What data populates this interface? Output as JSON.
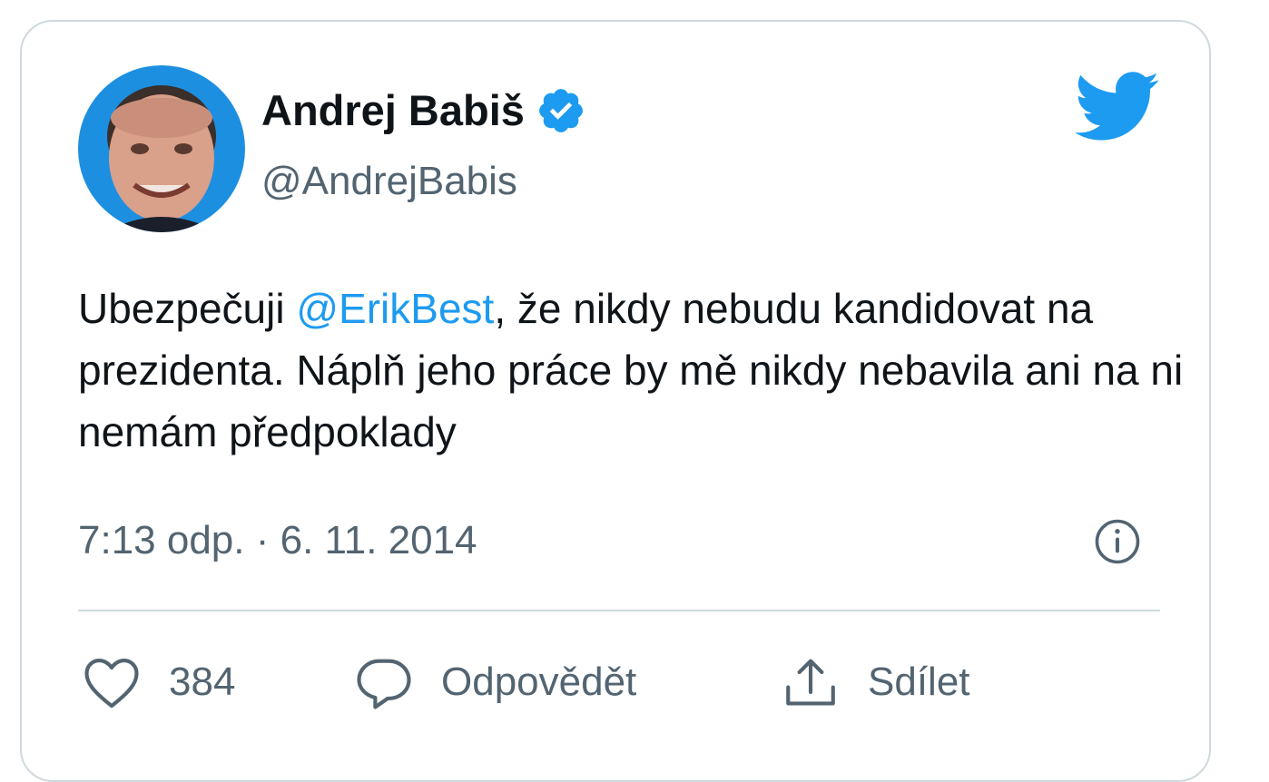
{
  "tweet": {
    "author_name": "Andrej Babiš",
    "handle": "@AndrejBabis",
    "text_before": "Ubezpečuji ",
    "mention": "@ErikBest",
    "text_after": ", že nikdy nebudu kandidovat na prezidenta. Náplň jeho práce by mě nikdy nebavila ani na ni nemám předpoklady",
    "timestamp": "7:13 odp. · 6. 11. 2014",
    "likes": "384",
    "reply_label": "Odpovědět",
    "share_label": "Sdílet"
  },
  "icons": {
    "verified": "verified-badge-icon",
    "brand": "twitter-bird-icon",
    "info": "info-icon",
    "like": "heart-icon",
    "reply": "speech-bubble-icon",
    "share": "share-icon"
  },
  "colors": {
    "brand_blue": "#1d9bf0",
    "text": "#0f1419",
    "secondary": "#536471",
    "border": "#cfd9de"
  }
}
